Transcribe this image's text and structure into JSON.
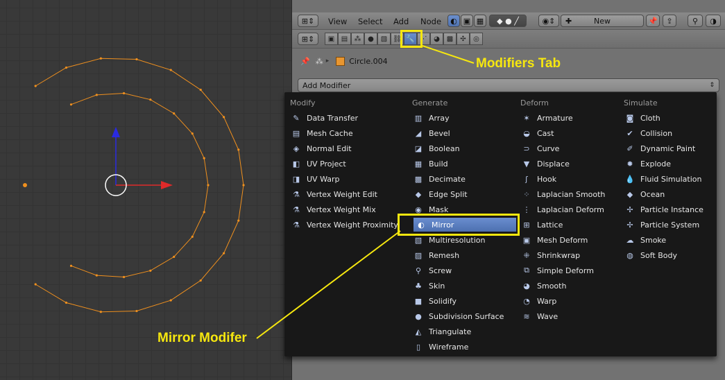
{
  "header": {
    "menus": [
      "View",
      "Select",
      "Add",
      "Node"
    ],
    "new_label": "New"
  },
  "context": {
    "object_name": "Circle.004"
  },
  "add_modifier": {
    "label": "Add Modifier"
  },
  "modifier_menu": {
    "columns": [
      {
        "title": "Modify",
        "items": [
          {
            "label": "Data Transfer",
            "icon": "data-transfer-icon"
          },
          {
            "label": "Mesh Cache",
            "icon": "mesh-cache-icon"
          },
          {
            "label": "Normal Edit",
            "icon": "normal-edit-icon"
          },
          {
            "label": "UV Project",
            "icon": "uv-project-icon"
          },
          {
            "label": "UV Warp",
            "icon": "uv-warp-icon"
          },
          {
            "label": "Vertex Weight Edit",
            "icon": "vertex-weight-icon"
          },
          {
            "label": "Vertex Weight Mix",
            "icon": "vertex-weight-icon"
          },
          {
            "label": "Vertex Weight Proximity",
            "icon": "vertex-weight-icon"
          }
        ]
      },
      {
        "title": "Generate",
        "items": [
          {
            "label": "Array",
            "icon": "array-icon"
          },
          {
            "label": "Bevel",
            "icon": "bevel-icon"
          },
          {
            "label": "Boolean",
            "icon": "boolean-icon"
          },
          {
            "label": "Build",
            "icon": "build-icon"
          },
          {
            "label": "Decimate",
            "icon": "decimate-icon"
          },
          {
            "label": "Edge Split",
            "icon": "edge-split-icon"
          },
          {
            "label": "Mask",
            "icon": "mask-icon"
          },
          {
            "label": "Mirror",
            "icon": "mirror-icon",
            "selected": true
          },
          {
            "label": "Multiresolution",
            "icon": "multires-icon"
          },
          {
            "label": "Remesh",
            "icon": "remesh-icon"
          },
          {
            "label": "Screw",
            "icon": "screw-icon"
          },
          {
            "label": "Skin",
            "icon": "skin-icon"
          },
          {
            "label": "Solidify",
            "icon": "solidify-icon"
          },
          {
            "label": "Subdivision Surface",
            "icon": "subsurf-icon"
          },
          {
            "label": "Triangulate",
            "icon": "triangulate-icon"
          },
          {
            "label": "Wireframe",
            "icon": "wireframe-icon"
          }
        ]
      },
      {
        "title": "Deform",
        "items": [
          {
            "label": "Armature",
            "icon": "armature-icon"
          },
          {
            "label": "Cast",
            "icon": "cast-icon"
          },
          {
            "label": "Curve",
            "icon": "curve-icon"
          },
          {
            "label": "Displace",
            "icon": "displace-icon"
          },
          {
            "label": "Hook",
            "icon": "hook-icon"
          },
          {
            "label": "Laplacian Smooth",
            "icon": "laplacian-smooth-icon"
          },
          {
            "label": "Laplacian Deform",
            "icon": "laplacian-deform-icon"
          },
          {
            "label": "Lattice",
            "icon": "lattice-icon"
          },
          {
            "label": "Mesh Deform",
            "icon": "mesh-deform-icon"
          },
          {
            "label": "Shrinkwrap",
            "icon": "shrinkwrap-icon"
          },
          {
            "label": "Simple Deform",
            "icon": "simple-deform-icon"
          },
          {
            "label": "Smooth",
            "icon": "smooth-icon"
          },
          {
            "label": "Warp",
            "icon": "warp-icon"
          },
          {
            "label": "Wave",
            "icon": "wave-icon"
          }
        ]
      },
      {
        "title": "Simulate",
        "items": [
          {
            "label": "Cloth",
            "icon": "cloth-icon"
          },
          {
            "label": "Collision",
            "icon": "collision-icon"
          },
          {
            "label": "Dynamic Paint",
            "icon": "dynamic-paint-icon"
          },
          {
            "label": "Explode",
            "icon": "explode-icon"
          },
          {
            "label": "Fluid Simulation",
            "icon": "fluid-icon"
          },
          {
            "label": "Ocean",
            "icon": "ocean-icon"
          },
          {
            "label": "Particle Instance",
            "icon": "particle-instance-icon"
          },
          {
            "label": "Particle System",
            "icon": "particle-system-icon"
          },
          {
            "label": "Smoke",
            "icon": "smoke-icon"
          },
          {
            "label": "Soft Body",
            "icon": "soft-body-icon"
          }
        ]
      }
    ]
  },
  "annotations": {
    "modifiers_tab": "Modifiers Tab",
    "mirror_modifier": "Mirror Modifer"
  },
  "colors": {
    "highlight": "#f6e70f",
    "selection": "#5a7fc0",
    "mesh_edge": "#f0901e"
  }
}
